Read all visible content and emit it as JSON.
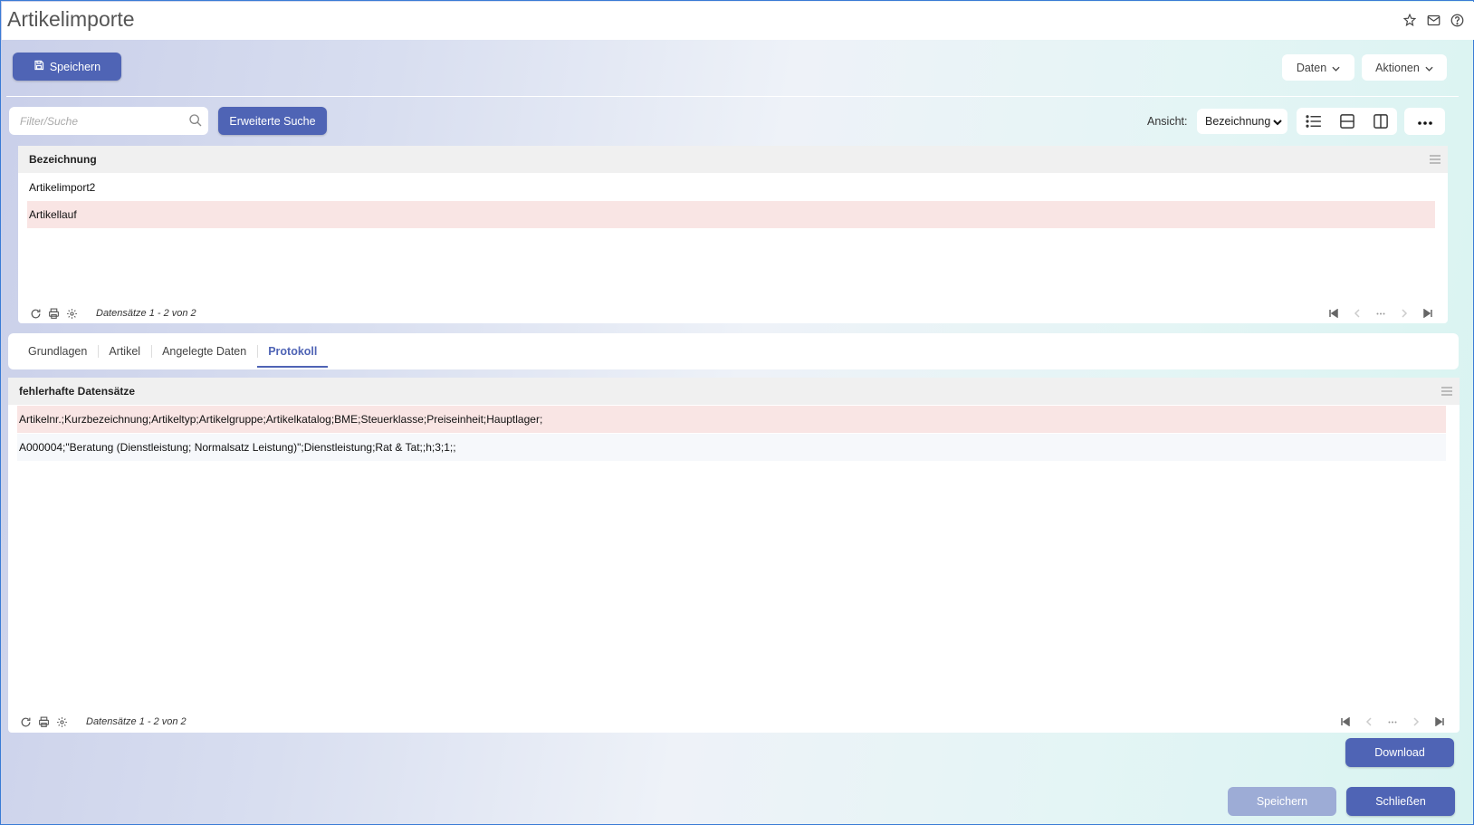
{
  "window": {
    "title": "Artikelimporte"
  },
  "title_icons": [
    "star-icon",
    "mail-icon",
    "help-icon"
  ],
  "toolbar": {
    "save_label": "Speichern",
    "daten_label": "Daten",
    "aktionen_label": "Aktionen"
  },
  "search": {
    "placeholder": "Filter/Suche",
    "value": "",
    "advanced_label": "Erweiterte Suche"
  },
  "view": {
    "label": "Ansicht:",
    "selected": "Bezeichnung"
  },
  "list": {
    "header": "Bezeichnung",
    "rows": [
      "Artikelimport2",
      "Artikellauf"
    ],
    "selected_index": 1,
    "count_text": "Datensätze 1 - 2 von 2"
  },
  "tabs": [
    {
      "label": "Grundlagen"
    },
    {
      "label": "Artikel"
    },
    {
      "label": "Angelegte Daten"
    },
    {
      "label": "Protokoll"
    }
  ],
  "active_tab": 3,
  "errors": {
    "header": "fehlerhafte Datensätze",
    "rows": [
      "Artikelnr.;Kurzbezeichnung;Artikeltyp;Artikelgruppe;Artikelkatalog;BME;Steuerklasse;Preiseinheit;Hauptlager;",
      "A000004;\"Beratung (Dienstleistung; Normalsatz Leistung)\";Dienstleistung;Rat & Tat;;h;3;1;;"
    ],
    "count_text": "Datensätze 1 - 2 von 2"
  },
  "actions": {
    "download_label": "Download",
    "save_label": "Speichern",
    "close_label": "Schließen"
  },
  "colors": {
    "primary": "#4f64b5",
    "disabled": "#9dacd6",
    "selected_row": "#f9e5e4"
  }
}
